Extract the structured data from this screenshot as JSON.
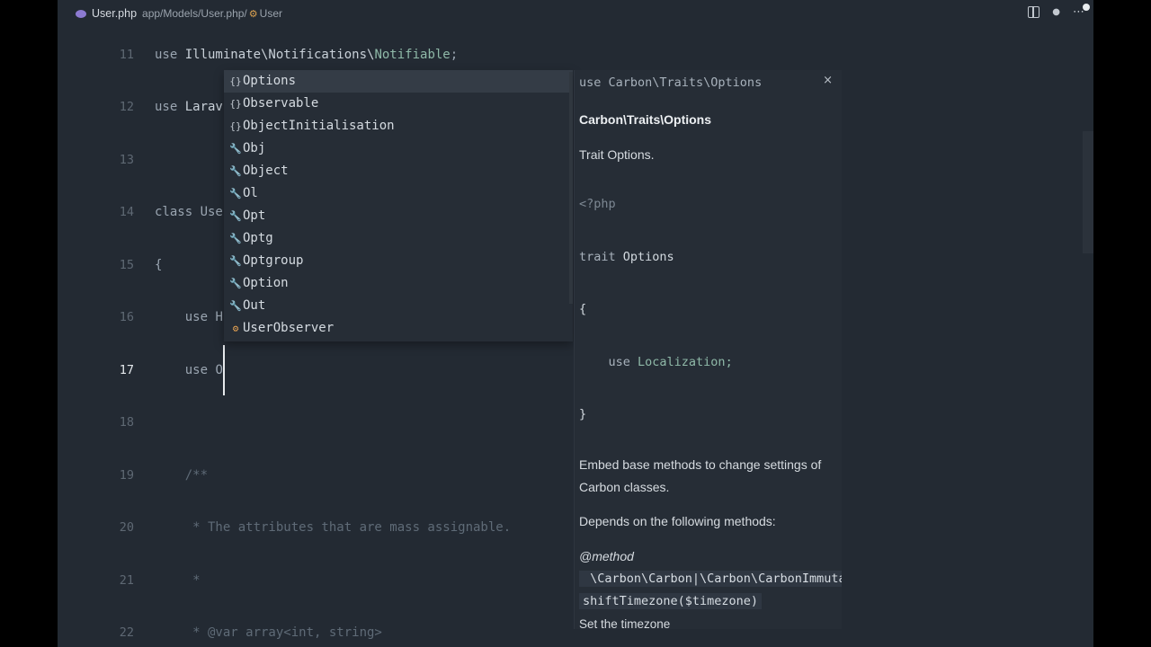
{
  "breadcrumb": {
    "file": "User.php",
    "path": "app/Models/User.php/",
    "symbol": "User"
  },
  "toolbar": {
    "more_icon": "⋯",
    "dot_icon": "●"
  },
  "editor": {
    "lines": [
      {
        "num": "11",
        "kw": "use ",
        "ns": "Illuminate\\Notifications\\",
        "cls": "Notifiable",
        "tail": ";"
      },
      {
        "num": "12",
        "kw": "use ",
        "ns": "Larav",
        "cls": "",
        "tail": ""
      },
      {
        "num": "13",
        "kw": "",
        "ns": "",
        "cls": "",
        "tail": ""
      },
      {
        "num": "14",
        "kw": "class ",
        "ns": "Use",
        "cls": "",
        "tail": ""
      },
      {
        "num": "15",
        "kw": "",
        "ns": "{",
        "cls": "",
        "tail": ""
      },
      {
        "num": "16",
        "kw": "    use ",
        "ns": "H",
        "cls": "",
        "tail": ""
      },
      {
        "num": "17",
        "kw": "    use ",
        "ns": "O",
        "cls": "",
        "tail": ""
      },
      {
        "num": "18",
        "kw": "",
        "ns": "",
        "cls": "",
        "tail": ""
      },
      {
        "num": "19",
        "cmt": "    /**"
      },
      {
        "num": "20",
        "cmt": "     * The attributes that are mass assignable."
      },
      {
        "num": "21",
        "cmt": "     *"
      },
      {
        "num": "22",
        "cmt": "     * @var array<int, string>"
      }
    ]
  },
  "suggestions": [
    {
      "icon": "{}",
      "label": "Options"
    },
    {
      "icon": "{}",
      "label": "Observable"
    },
    {
      "icon": "{}",
      "label": "ObjectInitialisation"
    },
    {
      "icon": "🔧",
      "label": "Obj"
    },
    {
      "icon": "🔧",
      "label": "Object"
    },
    {
      "icon": "🔧",
      "label": "Ol"
    },
    {
      "icon": "🔧",
      "label": "Opt"
    },
    {
      "icon": "🔧",
      "label": "Optg"
    },
    {
      "icon": "🔧",
      "label": "Optgroup"
    },
    {
      "icon": "🔧",
      "label": "Option"
    },
    {
      "icon": "🔧",
      "label": "Out"
    },
    {
      "icon": "⚙",
      "label": "UserObserver"
    }
  ],
  "docs": {
    "close": "×",
    "signature": "use Carbon\\Traits\\Options",
    "heading": "Carbon\\Traits\\Options",
    "summary": "Trait Options.",
    "code_open": "<?php",
    "code_trait_kw": "trait ",
    "code_trait_name": "Options",
    "code_brace_open": "{",
    "code_use_kw": "    use ",
    "code_use_name": "Localization;",
    "code_brace_close": "}",
    "desc_line1": "Embed base methods to change settings of",
    "desc_line2": "Carbon classes.",
    "depends": "Depends on the following methods:",
    "method_tag": "@method",
    "method_types": " \\Carbon\\Carbon|\\Carbon\\CarbonImmutab",
    "method_sig": "shiftTimezone($timezone)",
    "method_desc": "Set the timezone"
  }
}
